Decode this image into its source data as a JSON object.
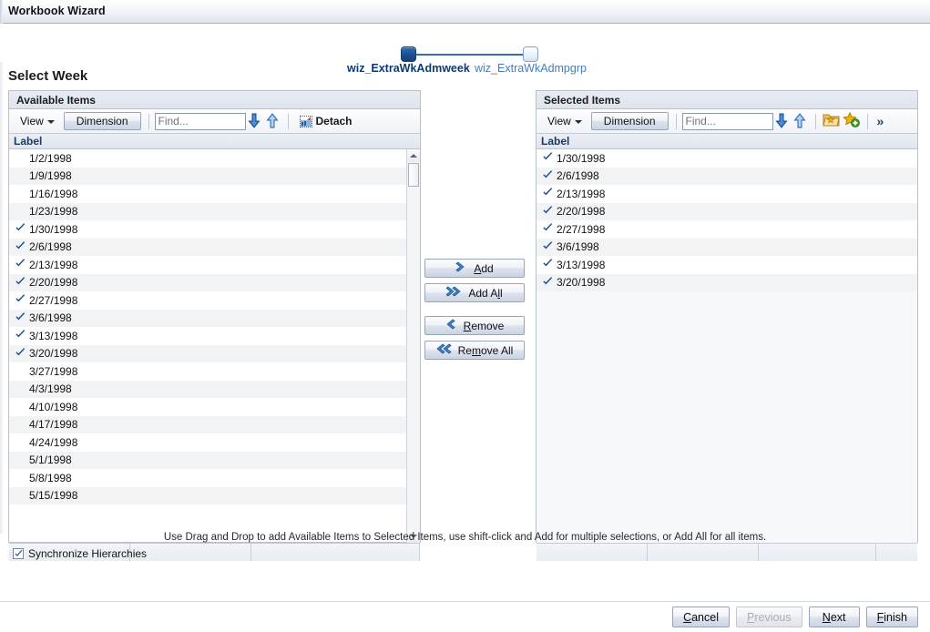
{
  "window": {
    "title": "Workbook Wizard"
  },
  "wizard": {
    "steps": [
      {
        "label": "wiz_ExtraWkAdmweek",
        "state": "active"
      },
      {
        "label": "wiz_ExtraWkAdmpgrp",
        "state": "inactive"
      }
    ]
  },
  "page": {
    "title": "Select Week"
  },
  "available": {
    "header": "Available Items",
    "toolbar": {
      "view_label": "View",
      "dimension_label": "Dimension",
      "find_placeholder": "Find...",
      "move_down_icon": "arrow-down-icon",
      "move_up_icon": "arrow-up-icon",
      "detach_label": "Detach",
      "detach_icon": "detach-icon"
    },
    "column_header": "Label",
    "rows": [
      {
        "label": "1/2/1998",
        "checked": false
      },
      {
        "label": "1/9/1998",
        "checked": false
      },
      {
        "label": "1/16/1998",
        "checked": false
      },
      {
        "label": "1/23/1998",
        "checked": false
      },
      {
        "label": "1/30/1998",
        "checked": true
      },
      {
        "label": "2/6/1998",
        "checked": true
      },
      {
        "label": "2/13/1998",
        "checked": true
      },
      {
        "label": "2/20/1998",
        "checked": true
      },
      {
        "label": "2/27/1998",
        "checked": true
      },
      {
        "label": "3/6/1998",
        "checked": true
      },
      {
        "label": "3/13/1998",
        "checked": true
      },
      {
        "label": "3/20/1998",
        "checked": true
      },
      {
        "label": "3/27/1998",
        "checked": false
      },
      {
        "label": "4/3/1998",
        "checked": false
      },
      {
        "label": "4/10/1998",
        "checked": false
      },
      {
        "label": "4/17/1998",
        "checked": false
      },
      {
        "label": "4/24/1998",
        "checked": false
      },
      {
        "label": "5/1/1998",
        "checked": false
      },
      {
        "label": "5/8/1998",
        "checked": false
      },
      {
        "label": "5/15/1998",
        "checked": false
      }
    ]
  },
  "selected": {
    "header": "Selected Items",
    "toolbar": {
      "view_label": "View",
      "dimension_label": "Dimension",
      "find_placeholder": "Find...",
      "move_down_icon": "arrow-down-icon",
      "move_up_icon": "arrow-up-icon",
      "saved_selections_icon": "folder-star-icon",
      "add_favorite_icon": "star-plus-icon",
      "overflow_label": "»"
    },
    "column_header": "Label",
    "rows": [
      {
        "label": "1/30/1998",
        "checked": true
      },
      {
        "label": "2/6/1998",
        "checked": true
      },
      {
        "label": "2/13/1998",
        "checked": true
      },
      {
        "label": "2/20/1998",
        "checked": true
      },
      {
        "label": "2/27/1998",
        "checked": true
      },
      {
        "label": "3/6/1998",
        "checked": true
      },
      {
        "label": "3/13/1998",
        "checked": true
      },
      {
        "label": "3/20/1998",
        "checked": true
      }
    ]
  },
  "transfer": {
    "add": {
      "pre": "",
      "key": "A",
      "post": "dd",
      "icon": "chevron-right-icon"
    },
    "add_all": {
      "pre": "Add A",
      "key": "l",
      "post": "l",
      "icon": "chevron-double-right-icon"
    },
    "remove": {
      "pre": "",
      "key": "R",
      "post": "emove",
      "icon": "chevron-left-icon"
    },
    "remove_all": {
      "pre": "Re",
      "key": "m",
      "post": "ove All",
      "icon": "chevron-double-left-icon"
    }
  },
  "hint": "Use Drag and Drop to add Available Items to Selected Items, use shift-click and Add for multiple selections, or Add All for all items.",
  "sync": {
    "label": "Synchronize Hierarchies",
    "checked": true
  },
  "footer": {
    "buttons": [
      {
        "pre": "",
        "key": "C",
        "post": "ancel",
        "disabled": false
      },
      {
        "pre": "",
        "key": "P",
        "post": "revious",
        "disabled": true
      },
      {
        "pre": "",
        "key": "N",
        "post": "ext",
        "disabled": false
      },
      {
        "pre": "",
        "key": "F",
        "post": "inish",
        "disabled": false
      }
    ]
  },
  "colors": {
    "accent": "#1e4f8f",
    "link": "#4a7cb5",
    "check": "#1f4e8c",
    "panel_header": "#e8ecf3",
    "row_alt": "#f2f3f5"
  }
}
